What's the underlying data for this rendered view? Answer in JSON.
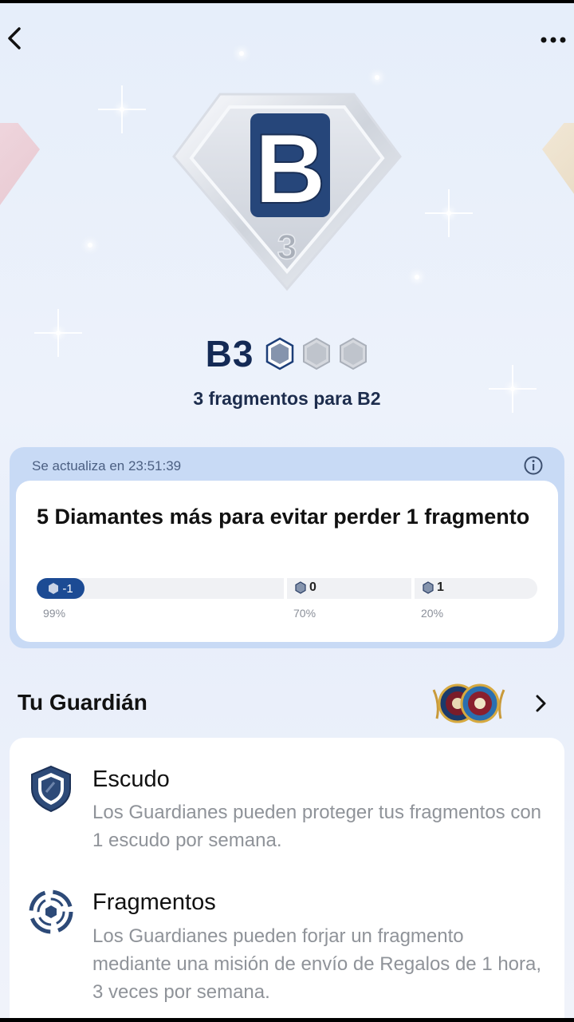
{
  "nav": {
    "back_icon": "chevron-left-icon",
    "more_icon": "more-dots-icon"
  },
  "rank": {
    "badge_letter": "B",
    "badge_number": "3",
    "title": "B3",
    "fragments_total": 3,
    "fragments_filled": 1,
    "fragments_needed_text": "3 fragmentos para B2"
  },
  "update_card": {
    "label": "Se actualiza en 23:51:39",
    "goal_text": "5 Diamantes más para evitar perder 1 fragmento",
    "progress": {
      "current_label": "-1",
      "milestones": [
        {
          "label": "0",
          "percent_label": "70%"
        },
        {
          "label": "1",
          "percent_label": "20%"
        }
      ],
      "start_percent_label": "99%"
    }
  },
  "guardian": {
    "title": "Tu Guardián"
  },
  "perks": [
    {
      "title": "Escudo",
      "description": "Los Guardianes pueden proteger tus fragmentos con 1 escudo por semana.",
      "icon": "shield-icon"
    },
    {
      "title": "Fragmentos",
      "description": "Los Guardianes pueden forjar un fragmento mediante una misión de envío de Regalos de 1 hora, 3 veces por semana.",
      "icon": "forge-icon"
    }
  ],
  "colors": {
    "accent": "#1c4b94",
    "title": "#142a55"
  }
}
